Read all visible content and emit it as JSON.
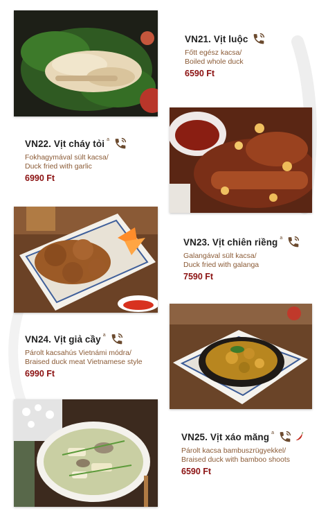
{
  "menu": {
    "items": [
      {
        "title": "VN21. Vịt luộc",
        "badge": "",
        "desc": [
          "Főtt egész kacsa/",
          "Boiled whole duck"
        ],
        "price": "6590 Ft"
      },
      {
        "title": "VN22. Vịt cháy tỏi",
        "badge": "a",
        "desc": [
          "Fokhagymával sült kacsa/",
          "Duck fried with garlic"
        ],
        "price": "6990 Ft"
      },
      {
        "title": "VN23. Vịt chiên riềng",
        "badge": "a",
        "desc": [
          "Galangával sült kacsa/",
          "Duck fried with galanga"
        ],
        "price": "7590 Ft"
      },
      {
        "title": "VN24. Vịt giả cầy",
        "badge": "a",
        "desc": [
          "Párolt kacsahús Vietnámi módra/",
          "Braised duck meat Vietnamese style"
        ],
        "price": "6990 Ft"
      },
      {
        "title": "VN25. Vịt xáo măng",
        "badge": "a",
        "desc": [
          "Párolt kacsa bambuszrügyekkel/",
          "Braised duck with bamboo shoots"
        ],
        "price": "6590 Ft"
      }
    ]
  },
  "icons": {
    "phone": "phone-ringing-icon",
    "chili": "chili-pepper-icon"
  },
  "colors": {
    "title": "#1f1f1f",
    "description": "#8a5a35",
    "price": "#8b1111",
    "icon": "#6b4a2e",
    "chili": "#c0281c"
  }
}
